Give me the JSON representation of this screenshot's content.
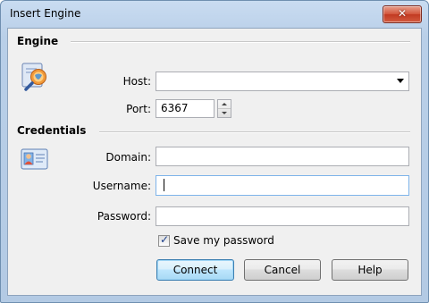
{
  "window": {
    "title": "Insert Engine",
    "close_symbol": "✕"
  },
  "engine": {
    "section_title": "Engine",
    "icon": "engine-globe-magnifier-icon",
    "host_label": "Host:",
    "host_value": "",
    "port_label": "Port:",
    "port_value": "6367"
  },
  "credentials": {
    "section_title": "Credentials",
    "icon": "id-card-icon",
    "domain_label": "Domain:",
    "domain_value": "",
    "username_label": "Username:",
    "username_value": "",
    "password_label": "Password:",
    "password_value": "",
    "save_password_label": "Save my password",
    "save_password_checked": true
  },
  "buttons": {
    "connect": "Connect",
    "cancel": "Cancel",
    "help": "Help"
  },
  "colors": {
    "accent": "#3c7fb1",
    "title_bar": "#c9dcf1",
    "close_button": "#c13a22"
  }
}
